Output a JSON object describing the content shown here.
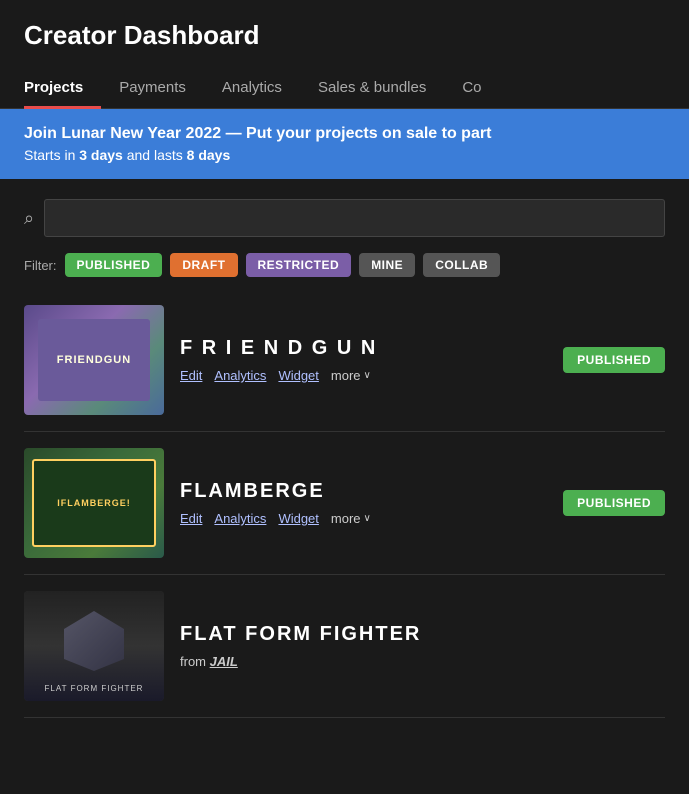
{
  "header": {
    "title": "Creator Dashboard"
  },
  "nav": {
    "tabs": [
      {
        "id": "projects",
        "label": "Projects",
        "active": true
      },
      {
        "id": "payments",
        "label": "Payments",
        "active": false
      },
      {
        "id": "analytics",
        "label": "Analytics",
        "active": false
      },
      {
        "id": "sales-bundles",
        "label": "Sales & bundles",
        "active": false
      },
      {
        "id": "co",
        "label": "Co",
        "active": false
      }
    ]
  },
  "banner": {
    "title_start": "Join Lunar New Year 2022",
    "title_rest": " — Put your projects on sale to part",
    "subtitle": "Starts in ",
    "days_start": "3 days",
    "subtitle_mid": " and lasts ",
    "days_end": "8 days"
  },
  "search": {
    "placeholder": ""
  },
  "filters": {
    "label": "Filter:",
    "buttons": [
      {
        "id": "published",
        "label": "PUBLISHED",
        "class": "published"
      },
      {
        "id": "draft",
        "label": "DRAFT",
        "class": "draft"
      },
      {
        "id": "restricted",
        "label": "RESTRICTED",
        "class": "restricted"
      },
      {
        "id": "mine",
        "label": "MINE",
        "class": "mine"
      },
      {
        "id": "collab",
        "label": "COLLAB",
        "class": "collab"
      }
    ]
  },
  "projects": [
    {
      "id": "friendgun",
      "name": "F R I E N D G U N",
      "name_class": "",
      "thumb_type": "friendgun",
      "thumb_label": "FRIENDGUN",
      "actions": [
        "Edit",
        "Analytics",
        "Widget"
      ],
      "more_label": "more",
      "status": "PUBLISHED",
      "sub": null
    },
    {
      "id": "flamberge",
      "name": "FLAMBERGE",
      "name_class": "",
      "thumb_type": "flamberge",
      "thumb_label": "iFLAMBERGE!",
      "actions": [
        "Edit",
        "Analytics",
        "Widget"
      ],
      "more_label": "more",
      "status": "PUBLISHED",
      "sub": null
    },
    {
      "id": "flat-form-fighter",
      "name": "FLAT FORM FIGHTER",
      "name_class": "",
      "thumb_type": "flatform",
      "thumb_label": "FLAT FORM FIGHTER",
      "actions": [],
      "more_label": null,
      "status": null,
      "sub": "from JAIL",
      "sub_jail": "JAIL"
    }
  ],
  "icons": {
    "search": "🔍",
    "chevron_down": "∨"
  }
}
